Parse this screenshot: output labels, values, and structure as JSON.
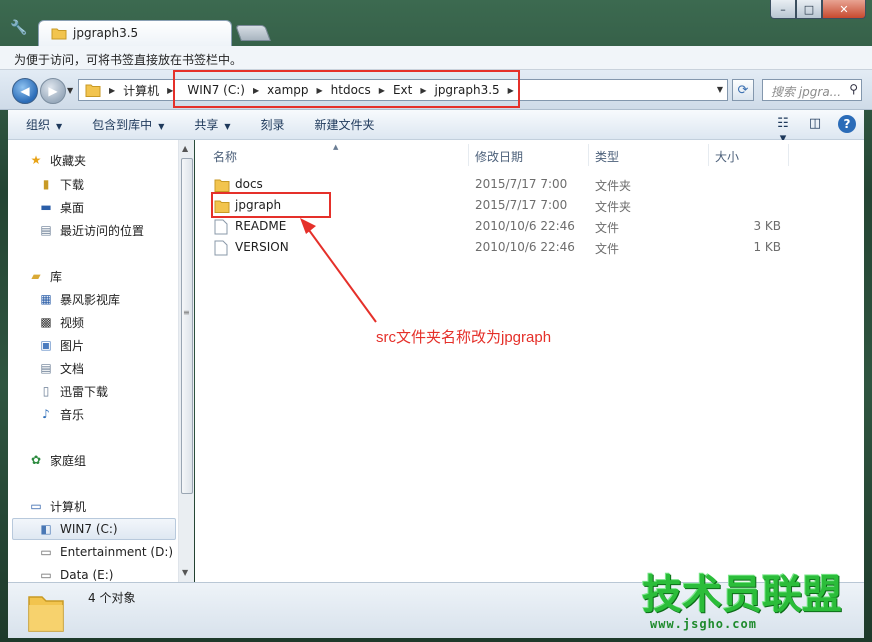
{
  "window": {
    "tab_title": "jpgraph3.5",
    "bookmark_hint": "为便于访问，可将书签直接放在书签栏中。",
    "caption": {
      "minimize": "–",
      "maximize": "□",
      "close": "✕"
    }
  },
  "address": {
    "crumbs": [
      "计算机",
      "WIN7 (C:)",
      "xampp",
      "htdocs",
      "Ext",
      "jpgraph3.5"
    ],
    "search_placeholder": "搜索 jpgra..."
  },
  "toolbar": {
    "organize": "组织",
    "include_in_library": "包含到库中",
    "share": "共享",
    "burn": "刻录",
    "new_folder": "新建文件夹"
  },
  "sidebar": {
    "favorites": "收藏夹",
    "downloads": "下载",
    "desktop": "桌面",
    "recent": "最近访问的位置",
    "libraries": "库",
    "storm": "暴风影视库",
    "videos": "视频",
    "pictures": "图片",
    "documents": "文档",
    "thunder": "迅雷下载",
    "music": "音乐",
    "homegroup": "家庭组",
    "computer": "计算机",
    "drive_c": "WIN7 (C:)",
    "drive_d": "Entertainment (D:)",
    "drive_e": "Data (E:)"
  },
  "columns": {
    "name": "名称",
    "date": "修改日期",
    "type": "类型",
    "size": "大小"
  },
  "files": [
    {
      "name": "docs",
      "date": "2015/7/17 7:00",
      "type": "文件夹",
      "size": "",
      "kind": "folder"
    },
    {
      "name": "jpgraph",
      "date": "2015/7/17 7:00",
      "type": "文件夹",
      "size": "",
      "kind": "folder"
    },
    {
      "name": "README",
      "date": "2010/10/6 22:46",
      "type": "文件",
      "size": "3 KB",
      "kind": "file"
    },
    {
      "name": "VERSION",
      "date": "2010/10/6 22:46",
      "type": "文件",
      "size": "1 KB",
      "kind": "file"
    }
  ],
  "annotation": "src文件夹名称改为jpgraph",
  "status": {
    "count": "4 个对象"
  },
  "watermark": {
    "title": "技术员联盟",
    "url": "www.jsgho.com"
  },
  "colors": {
    "annotation_red": "#e5302a",
    "watermark_green": "#2bbd3a",
    "folder_yellow": "#f2c44e"
  }
}
